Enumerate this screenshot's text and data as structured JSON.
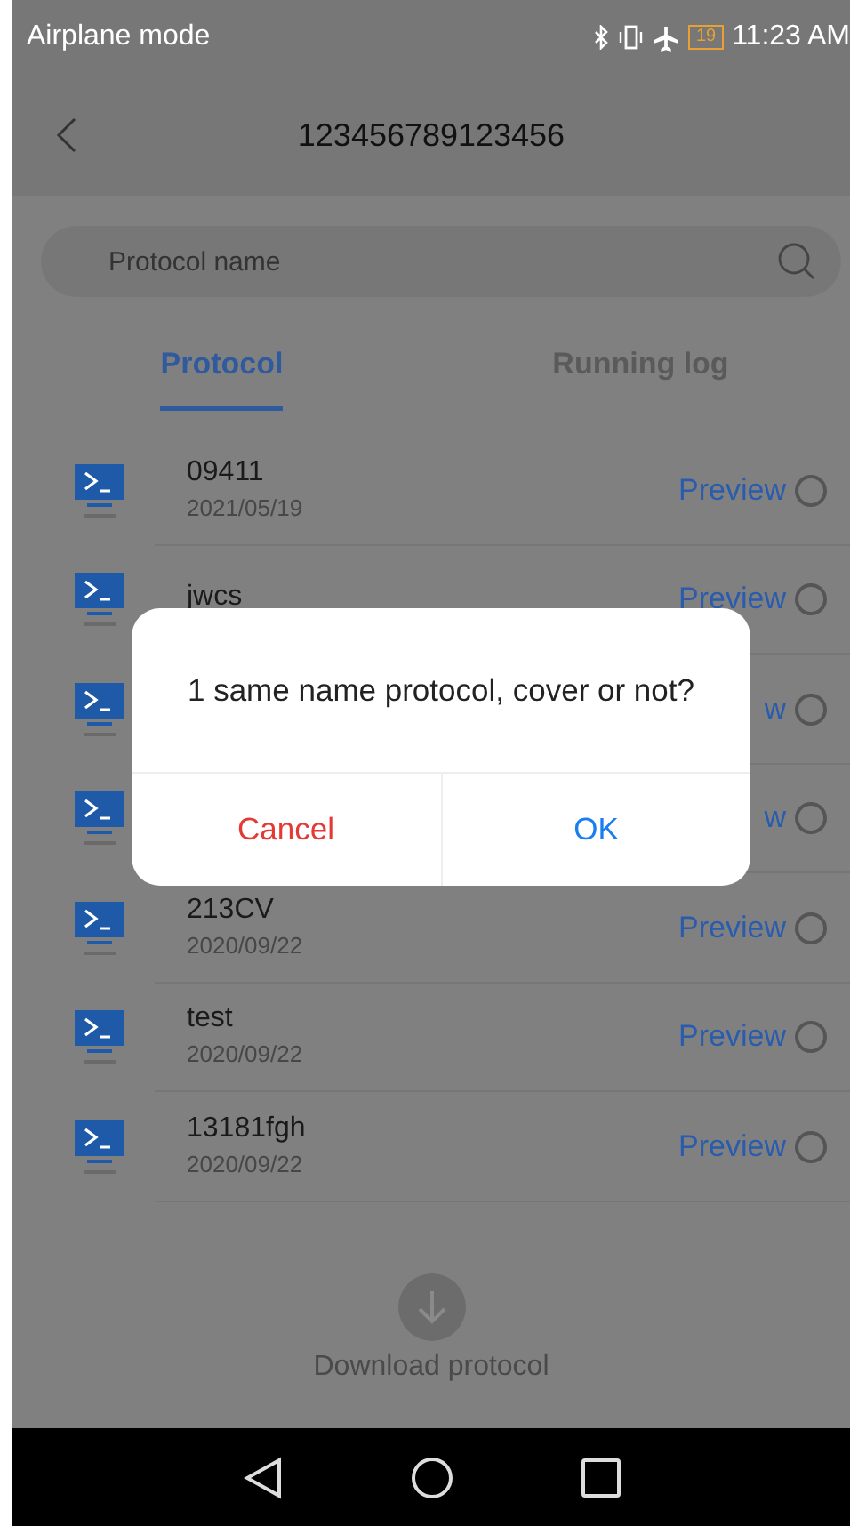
{
  "status_bar": {
    "mode": "Airplane mode",
    "battery": "19",
    "time": "11:23 AM"
  },
  "header": {
    "title": "123456789123456"
  },
  "search": {
    "placeholder": "Protocol name"
  },
  "tabs": [
    {
      "label": "Protocol",
      "selected": true
    },
    {
      "label": "Running log",
      "selected": false
    }
  ],
  "protocols": [
    {
      "name": "09411",
      "date": "2021/05/19",
      "preview": "Preview",
      "checked": false
    },
    {
      "name": "jwcs",
      "preview": "Preview",
      "checked": false
    },
    {
      "preview": "w",
      "checked": false
    },
    {
      "preview": "w",
      "checked": false
    },
    {
      "name": "213CV",
      "date": "2020/09/22",
      "preview": "Preview",
      "checked": false
    },
    {
      "name": "test",
      "date": "2020/09/22",
      "preview": "Preview",
      "checked": false
    },
    {
      "name": "13181fgh",
      "date": "2020/09/22",
      "preview": "Preview",
      "checked": false
    }
  ],
  "download": {
    "label": "Download protocol"
  },
  "dialog": {
    "message": "1 same name protocol, cover or not?",
    "buttons": [
      {
        "label": "Cancel",
        "kind": "cancel"
      },
      {
        "label": "OK",
        "kind": "confirm"
      }
    ]
  }
}
